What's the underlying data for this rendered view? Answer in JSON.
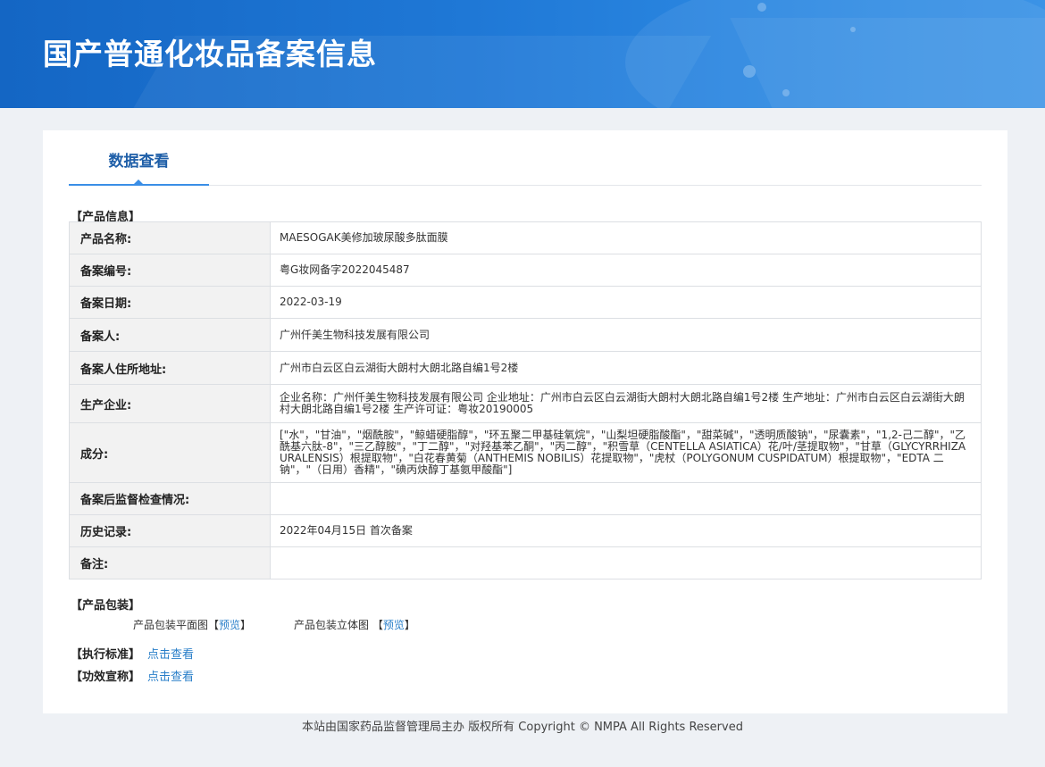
{
  "header": {
    "title": "国产普通化妆品备案信息"
  },
  "tabs": [
    {
      "label": "数据查看"
    }
  ],
  "product_info": {
    "section_title": "【产品信息】",
    "rows": [
      {
        "label": "产品名称:",
        "value": "MAESOGAK美修加玻尿酸多肽面膜"
      },
      {
        "label": "备案编号:",
        "value": "粤G妆网备字2022045487"
      },
      {
        "label": "备案日期:",
        "value": "2022-03-19"
      },
      {
        "label": "备案人:",
        "value": "广州仟美生物科技发展有限公司"
      },
      {
        "label": "备案人住所地址:",
        "value": "广州市白云区白云湖街大朗村大朗北路自编1号2楼"
      },
      {
        "label": "生产企业:",
        "value": "企业名称：广州仟美生物科技发展有限公司 企业地址：广州市白云区白云湖街大朗村大朗北路自编1号2楼 生产地址：广州市白云区白云湖街大朗村大朗北路自编1号2楼 生产许可证：粤妆20190005"
      },
      {
        "label": "成分:",
        "value": "[\"水\"，\"甘油\"，\"烟酰胺\"，\"鲸蜡硬脂醇\"，\"环五聚二甲基硅氧烷\"，\"山梨坦硬脂酸酯\"，\"甜菜碱\"，\"透明质酸钠\"，\"尿囊素\"，\"1,2-己二醇\"，\"乙酰基六肽-8\"，\"三乙醇胺\"，\"丁二醇\"，\"对羟基苯乙酮\"，\"丙二醇\"，\"积雪草（CENTELLA ASIATICA）花/叶/茎提取物\"，\"甘草（GLYCYRRHIZA URALENSIS）根提取物\"，\"白花春黄菊（ANTHEMIS NOBILIS）花提取物\"，\"虎杖（POLYGONUM CUSPIDATUM）根提取物\"，\"EDTA 二钠\"，\"（日用）香精\"，\"碘丙炔醇丁基氨甲酸酯\"]"
      },
      {
        "label": "备案后监督检查情况:",
        "value": ""
      },
      {
        "label": "历史记录:",
        "value": "2022年04月15日 首次备案"
      },
      {
        "label": "备注:",
        "value": ""
      }
    ]
  },
  "packaging": {
    "section_title": "【产品包装】",
    "flat_label": "产品包装平面图",
    "three_d_label": "产品包装立体图",
    "bracket_open": "【",
    "bracket_close": "】",
    "preview_link": "预览"
  },
  "standard": {
    "label": "【执行标准】",
    "link": "点击查看"
  },
  "efficacy": {
    "label": "【功效宣称】",
    "link": "点击查看"
  },
  "footer": {
    "text": "本站由国家药品监督管理局主办 版权所有 Copyright © NMPA All Rights Reserved"
  }
}
